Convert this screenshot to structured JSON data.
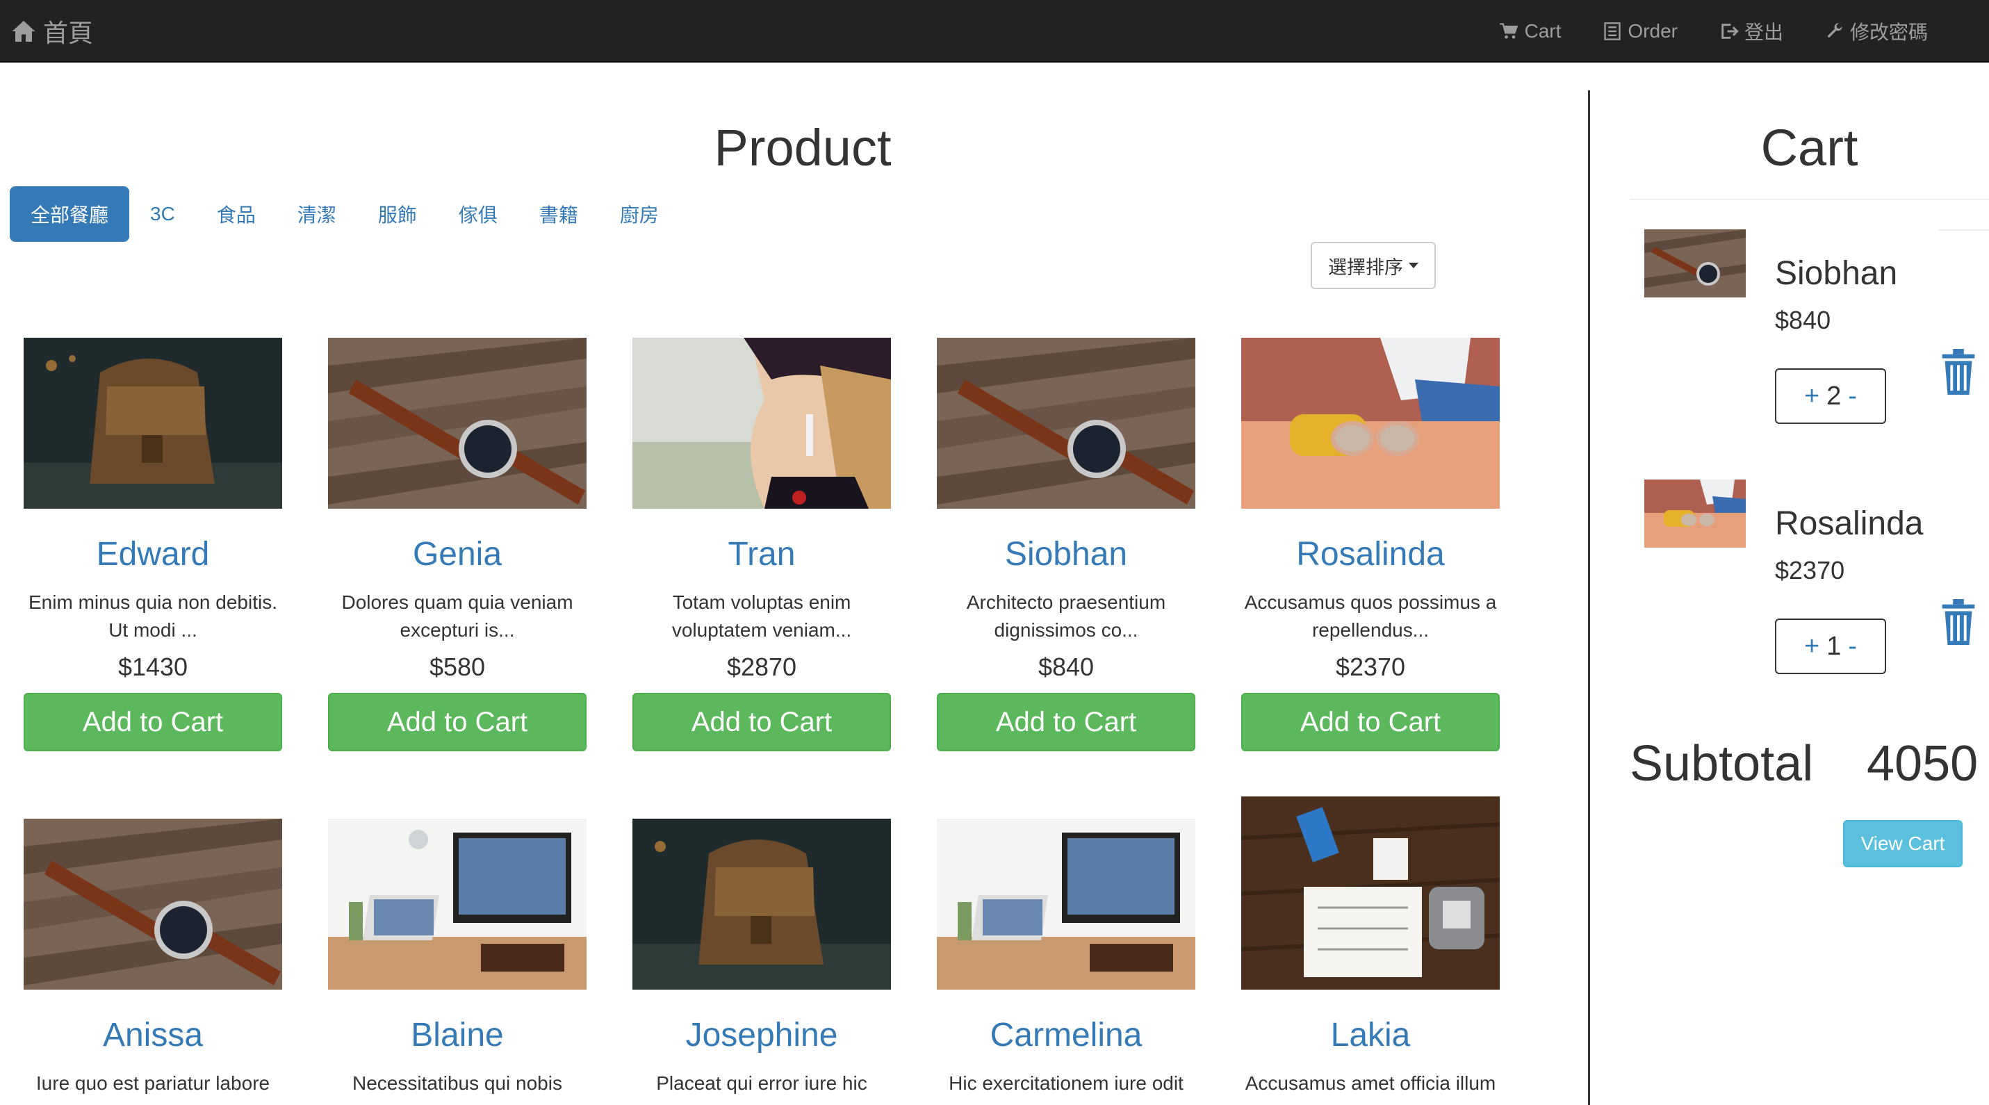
{
  "nav": {
    "brand": "首頁",
    "links": [
      {
        "label": "Cart",
        "icon": "cart-icon"
      },
      {
        "label": "Order",
        "icon": "list-icon"
      },
      {
        "label": "登出",
        "icon": "logout-icon"
      },
      {
        "label": "修改密碼",
        "icon": "wrench-icon"
      }
    ]
  },
  "products": {
    "title": "Product",
    "tabs": [
      "全部餐廳",
      "3C",
      "食品",
      "清潔",
      "服飾",
      "傢俱",
      "書籍",
      "廚房"
    ],
    "active_tab": "全部餐廳",
    "sort_label": "選擇排序",
    "items": [
      {
        "name": "Edward",
        "desc1": "Enim minus quia non debitis.",
        "desc2": "Ut modi ...",
        "price": "$1430",
        "button": "Add to Cart",
        "image": "backpack"
      },
      {
        "name": "Genia",
        "desc1": "Dolores quam quia veniam",
        "desc2": "excepturi is...",
        "price": "$580",
        "button": "Add to Cart",
        "image": "watch"
      },
      {
        "name": "Tran",
        "desc1": "Totam voluptas enim",
        "desc2": "voluptatem veniam...",
        "price": "$2870",
        "button": "Add to Cart",
        "image": "woman-earring"
      },
      {
        "name": "Siobhan",
        "desc1": "Architecto praesentium",
        "desc2": "dignissimos co...",
        "price": "$840",
        "button": "Add to Cart",
        "image": "watch"
      },
      {
        "name": "Rosalinda",
        "desc1": "Accusamus quos possimus a",
        "desc2": "repellendus...",
        "price": "$2370",
        "button": "Add to Cart",
        "image": "sunglasses"
      },
      {
        "name": "Anissa",
        "desc1": "Iure quo est pariatur labore",
        "desc2": "",
        "price": "",
        "button": "",
        "image": "watch"
      },
      {
        "name": "Blaine",
        "desc1": "Necessitatibus qui nobis",
        "desc2": "",
        "price": "",
        "button": "",
        "image": "desk"
      },
      {
        "name": "Josephine",
        "desc1": "Placeat qui error iure hic",
        "desc2": "",
        "price": "",
        "button": "",
        "image": "backpack"
      },
      {
        "name": "Carmelina",
        "desc1": "Hic exercitationem iure odit",
        "desc2": "",
        "price": "",
        "button": "",
        "image": "desk"
      },
      {
        "name": "Lakia",
        "desc1": "Accusamus amet officia illum",
        "desc2": "",
        "price": "",
        "button": "",
        "image": "notebook"
      }
    ]
  },
  "cart": {
    "title": "Cart",
    "items": [
      {
        "name": "Siobhan",
        "price": "$840",
        "qty": "2",
        "plus": "+",
        "minus": "-",
        "image": "watch"
      },
      {
        "name": "Rosalinda",
        "price": "$2370",
        "qty": "1",
        "plus": "+",
        "minus": "-",
        "image": "sunglasses"
      }
    ],
    "subtotal_label": "Subtotal",
    "subtotal_value": "4050",
    "view_cart": "View Cart"
  },
  "colors": {
    "navbar_bg": "#222222",
    "nav_text": "#9d9d9d",
    "primary": "#337ab7",
    "success": "#5cb85c",
    "info": "#5bc0de"
  }
}
